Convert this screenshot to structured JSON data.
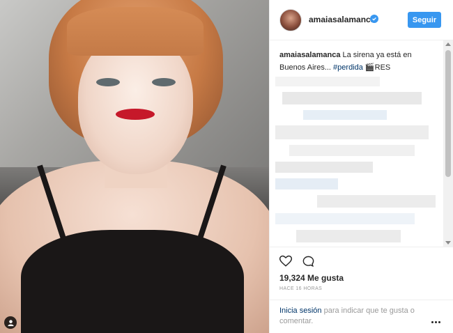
{
  "post": {
    "username": "amaiasalamanca",
    "follow_label": "Seguir",
    "caption_user": "amaiasalamanca",
    "caption_text": " La sirena ya está en Buenos Aires... ",
    "caption_hashtag": "#perdida",
    "caption_emoji": " 🎬RES",
    "likes": "19,324 Me gusta",
    "time": "HACE 16 HORAS",
    "login_link": "Inicia sesión",
    "login_text": " para indicar que te gusta o comentar."
  },
  "icons": {
    "like": "heart-icon",
    "comment": "comment-icon",
    "more": "more-options-icon",
    "verified": "verified-badge-icon",
    "user_tag": "user-tag-icon"
  },
  "colors": {
    "accent": "#3897f0",
    "link": "#003569",
    "muted": "#999999"
  }
}
